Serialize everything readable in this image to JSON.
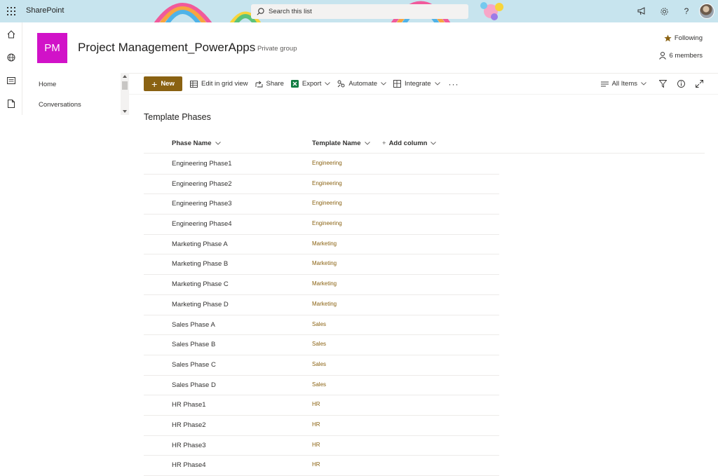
{
  "suite": {
    "app_name": "SharePoint",
    "search_placeholder": "Search this list"
  },
  "site": {
    "logo_initials": "PM",
    "logo_color": "#d112c8",
    "title": "Project Management_PowerApps",
    "type": "Private group",
    "following_label": "Following",
    "members_label": "6 members"
  },
  "nav": {
    "items": [
      {
        "label": "Home"
      },
      {
        "label": "Conversations"
      }
    ]
  },
  "commandbar": {
    "new_label": "New",
    "edit_grid_label": "Edit in grid view",
    "share_label": "Share",
    "export_label": "Export",
    "automate_label": "Automate",
    "integrate_label": "Integrate",
    "view_label": "All Items",
    "accent_color": "#8a6212"
  },
  "list": {
    "title": "Template Phases",
    "columns": [
      "Phase Name",
      "Template Name",
      "Add column"
    ],
    "rows": [
      {
        "phase": "Engineering Phase1",
        "template": "Engineering"
      },
      {
        "phase": "Engineering Phase2",
        "template": "Engineering"
      },
      {
        "phase": "Engineering Phase3",
        "template": "Engineering"
      },
      {
        "phase": "Engineering Phase4",
        "template": "Engineering"
      },
      {
        "phase": "Marketing Phase A",
        "template": "Marketing"
      },
      {
        "phase": "Marketing Phase B",
        "template": "Marketing"
      },
      {
        "phase": "Marketing Phase C",
        "template": "Marketing"
      },
      {
        "phase": "Marketing Phase D",
        "template": "Marketing"
      },
      {
        "phase": "Sales Phase A",
        "template": "Sales"
      },
      {
        "phase": "Sales Phase B",
        "template": "Sales"
      },
      {
        "phase": "Sales Phase C",
        "template": "Sales"
      },
      {
        "phase": "Sales Phase D",
        "template": "Sales"
      },
      {
        "phase": "HR Phase1",
        "template": "HR"
      },
      {
        "phase": "HR Phase2",
        "template": "HR"
      },
      {
        "phase": "HR Phase3",
        "template": "HR"
      },
      {
        "phase": "HR Phase4",
        "template": "HR"
      }
    ]
  }
}
